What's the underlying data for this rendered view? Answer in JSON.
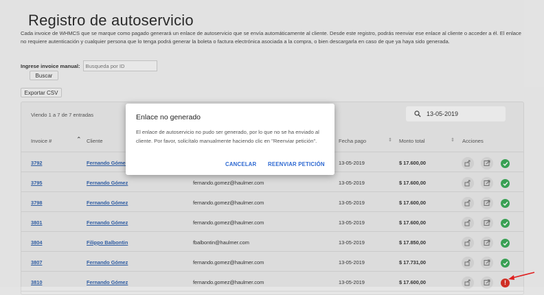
{
  "page": {
    "title": "Registro de autoservicio",
    "description": "Cada invoice de WHMCS que se marque como pagado generará un enlace de autoservicio que se envía automáticamente al cliente. Desde este registro, podrás reenviar ese enlace al cliente o acceder a él. El enlace no requiere autenticación y cualquier persona que lo tenga podrá generar la boleta o factura electrónica asociada a la compra, o bien descargarla en caso de que ya haya sido generada."
  },
  "manual_search": {
    "label": "Ingrese invoice manual:",
    "placeholder": "Busqueda por ID",
    "button": "Buscar"
  },
  "export_button": "Exportar CSV",
  "table": {
    "entries_info": "Viendo 1 a 7 de 7 entradas",
    "search_value": "13-05-2019",
    "headers": {
      "invoice": "Invoice #",
      "client": "Cliente",
      "date": "Fecha pago",
      "amount": "Monto total",
      "actions": "Acciones"
    },
    "rows": [
      {
        "invoice": "3792",
        "client": "Fernando Gómez",
        "email": "",
        "date": "13-05-2019",
        "amount": "$ 17.600,00",
        "status": "ok"
      },
      {
        "invoice": "3795",
        "client": "Fernando Gómez",
        "email": "fernando.gomez@haulmer.com",
        "date": "13-05-2019",
        "amount": "$ 17.600,00",
        "status": "ok"
      },
      {
        "invoice": "3798",
        "client": "Fernando Gómez",
        "email": "fernando.gomez@haulmer.com",
        "date": "13-05-2019",
        "amount": "$ 17.600,00",
        "status": "ok"
      },
      {
        "invoice": "3801",
        "client": "Fernando Gómez",
        "email": "fernando.gomez@haulmer.com",
        "date": "13-05-2019",
        "amount": "$ 17.600,00",
        "status": "ok"
      },
      {
        "invoice": "3804",
        "client": "Filippo Balbontin",
        "email": "fbalbontin@haulmer.com",
        "date": "13-05-2019",
        "amount": "$ 17.850,00",
        "status": "ok"
      },
      {
        "invoice": "3807",
        "client": "Fernando Gómez",
        "email": "fernando.gomez@haulmer.com",
        "date": "13-05-2019",
        "amount": "$ 17.731,00",
        "status": "ok"
      },
      {
        "invoice": "3810",
        "client": "Fernando Gómez",
        "email": "fernando.gomez@haulmer.com",
        "date": "13-05-2019",
        "amount": "$ 17.600,00",
        "status": "error"
      }
    ]
  },
  "modal": {
    "title": "Enlace no generado",
    "text": "El enlace de autoservicio no pudo ser generado, por lo que no se ha enviado al cliente. Por favor, solicítalo manualmente haciendo clic en \"Reenviar petición\".",
    "cancel": "CANCELAR",
    "resend": "REENVIAR PETICIÓN"
  },
  "colors": {
    "link": "#2e5ea8",
    "ok": "#3aa757",
    "error": "#d93025",
    "accent": "#2b67d1"
  }
}
